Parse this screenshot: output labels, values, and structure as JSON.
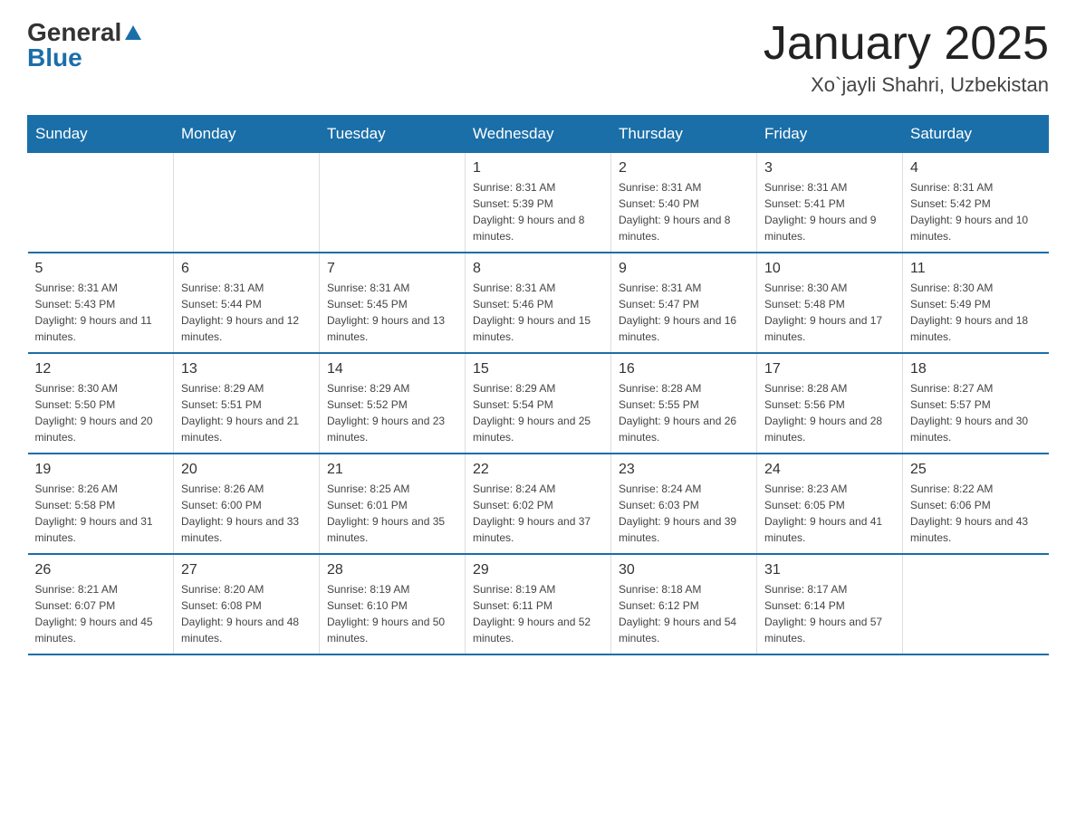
{
  "header": {
    "logo_general": "General",
    "logo_blue": "Blue",
    "title": "January 2025",
    "subtitle": "Xo`jayli Shahri, Uzbekistan"
  },
  "days_of_week": [
    "Sunday",
    "Monday",
    "Tuesday",
    "Wednesday",
    "Thursday",
    "Friday",
    "Saturday"
  ],
  "weeks": [
    {
      "days": [
        {
          "num": "",
          "info": ""
        },
        {
          "num": "",
          "info": ""
        },
        {
          "num": "",
          "info": ""
        },
        {
          "num": "1",
          "info": "Sunrise: 8:31 AM\nSunset: 5:39 PM\nDaylight: 9 hours and 8 minutes."
        },
        {
          "num": "2",
          "info": "Sunrise: 8:31 AM\nSunset: 5:40 PM\nDaylight: 9 hours and 8 minutes."
        },
        {
          "num": "3",
          "info": "Sunrise: 8:31 AM\nSunset: 5:41 PM\nDaylight: 9 hours and 9 minutes."
        },
        {
          "num": "4",
          "info": "Sunrise: 8:31 AM\nSunset: 5:42 PM\nDaylight: 9 hours and 10 minutes."
        }
      ]
    },
    {
      "days": [
        {
          "num": "5",
          "info": "Sunrise: 8:31 AM\nSunset: 5:43 PM\nDaylight: 9 hours and 11 minutes."
        },
        {
          "num": "6",
          "info": "Sunrise: 8:31 AM\nSunset: 5:44 PM\nDaylight: 9 hours and 12 minutes."
        },
        {
          "num": "7",
          "info": "Sunrise: 8:31 AM\nSunset: 5:45 PM\nDaylight: 9 hours and 13 minutes."
        },
        {
          "num": "8",
          "info": "Sunrise: 8:31 AM\nSunset: 5:46 PM\nDaylight: 9 hours and 15 minutes."
        },
        {
          "num": "9",
          "info": "Sunrise: 8:31 AM\nSunset: 5:47 PM\nDaylight: 9 hours and 16 minutes."
        },
        {
          "num": "10",
          "info": "Sunrise: 8:30 AM\nSunset: 5:48 PM\nDaylight: 9 hours and 17 minutes."
        },
        {
          "num": "11",
          "info": "Sunrise: 8:30 AM\nSunset: 5:49 PM\nDaylight: 9 hours and 18 minutes."
        }
      ]
    },
    {
      "days": [
        {
          "num": "12",
          "info": "Sunrise: 8:30 AM\nSunset: 5:50 PM\nDaylight: 9 hours and 20 minutes."
        },
        {
          "num": "13",
          "info": "Sunrise: 8:29 AM\nSunset: 5:51 PM\nDaylight: 9 hours and 21 minutes."
        },
        {
          "num": "14",
          "info": "Sunrise: 8:29 AM\nSunset: 5:52 PM\nDaylight: 9 hours and 23 minutes."
        },
        {
          "num": "15",
          "info": "Sunrise: 8:29 AM\nSunset: 5:54 PM\nDaylight: 9 hours and 25 minutes."
        },
        {
          "num": "16",
          "info": "Sunrise: 8:28 AM\nSunset: 5:55 PM\nDaylight: 9 hours and 26 minutes."
        },
        {
          "num": "17",
          "info": "Sunrise: 8:28 AM\nSunset: 5:56 PM\nDaylight: 9 hours and 28 minutes."
        },
        {
          "num": "18",
          "info": "Sunrise: 8:27 AM\nSunset: 5:57 PM\nDaylight: 9 hours and 30 minutes."
        }
      ]
    },
    {
      "days": [
        {
          "num": "19",
          "info": "Sunrise: 8:26 AM\nSunset: 5:58 PM\nDaylight: 9 hours and 31 minutes."
        },
        {
          "num": "20",
          "info": "Sunrise: 8:26 AM\nSunset: 6:00 PM\nDaylight: 9 hours and 33 minutes."
        },
        {
          "num": "21",
          "info": "Sunrise: 8:25 AM\nSunset: 6:01 PM\nDaylight: 9 hours and 35 minutes."
        },
        {
          "num": "22",
          "info": "Sunrise: 8:24 AM\nSunset: 6:02 PM\nDaylight: 9 hours and 37 minutes."
        },
        {
          "num": "23",
          "info": "Sunrise: 8:24 AM\nSunset: 6:03 PM\nDaylight: 9 hours and 39 minutes."
        },
        {
          "num": "24",
          "info": "Sunrise: 8:23 AM\nSunset: 6:05 PM\nDaylight: 9 hours and 41 minutes."
        },
        {
          "num": "25",
          "info": "Sunrise: 8:22 AM\nSunset: 6:06 PM\nDaylight: 9 hours and 43 minutes."
        }
      ]
    },
    {
      "days": [
        {
          "num": "26",
          "info": "Sunrise: 8:21 AM\nSunset: 6:07 PM\nDaylight: 9 hours and 45 minutes."
        },
        {
          "num": "27",
          "info": "Sunrise: 8:20 AM\nSunset: 6:08 PM\nDaylight: 9 hours and 48 minutes."
        },
        {
          "num": "28",
          "info": "Sunrise: 8:19 AM\nSunset: 6:10 PM\nDaylight: 9 hours and 50 minutes."
        },
        {
          "num": "29",
          "info": "Sunrise: 8:19 AM\nSunset: 6:11 PM\nDaylight: 9 hours and 52 minutes."
        },
        {
          "num": "30",
          "info": "Sunrise: 8:18 AM\nSunset: 6:12 PM\nDaylight: 9 hours and 54 minutes."
        },
        {
          "num": "31",
          "info": "Sunrise: 8:17 AM\nSunset: 6:14 PM\nDaylight: 9 hours and 57 minutes."
        },
        {
          "num": "",
          "info": ""
        }
      ]
    }
  ]
}
